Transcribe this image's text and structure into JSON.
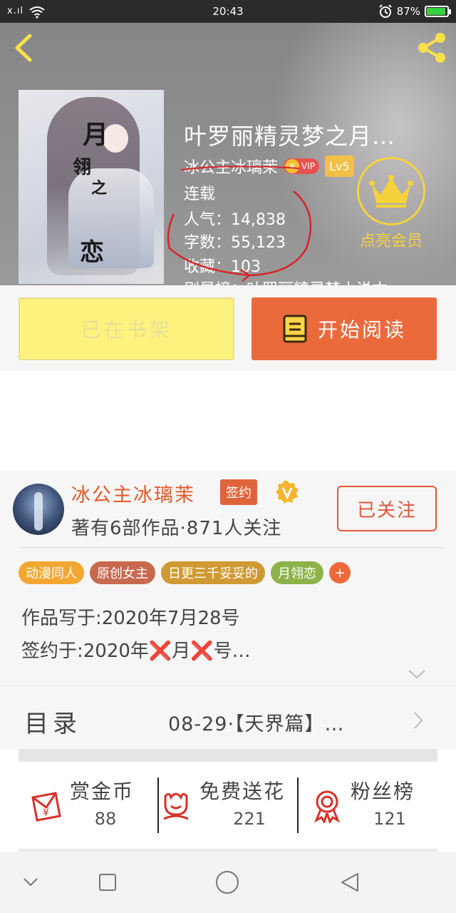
{
  "status_bar": {
    "signal": "x.ıl",
    "time": "20:43",
    "battery_text": "87%",
    "battery_level": 0.87
  },
  "book": {
    "title": "叶罗丽精灵梦之月…",
    "author": "冰公主冰璃茉",
    "vip_label": "VIP",
    "level": "Lv5",
    "status": "连载",
    "popularity": "人气：14,838",
    "word_count": "字数：55,123",
    "favorites": "收藏：103",
    "ranking": "剧星榜：叶罗丽精灵梦小说本…",
    "cover_chars": [
      "月",
      "翎",
      "之",
      "恋"
    ]
  },
  "member": {
    "label": "点亮会员"
  },
  "actions": {
    "shelf_label": "已在书架",
    "read_label": "开始阅读"
  },
  "author_card": {
    "name": "冰公主冰璃茉",
    "sign_tag": "签约",
    "meta": "著有6部作品·871人关注",
    "follow_label": "已关注",
    "tags": [
      {
        "label": "动漫同人",
        "color": "#f2a733"
      },
      {
        "label": "原创女主",
        "color": "#c8694f"
      },
      {
        "label": "日更三千妥妥的",
        "color": "#cf9a33"
      },
      {
        "label": "月翎恋",
        "color": "#8db24a"
      },
      {
        "label": "+",
        "color": "#ec6a3b"
      }
    ],
    "written_on": "作品写于:2020年7月28号",
    "signed_on": "签约于:2020年❌月❌号…"
  },
  "catalog": {
    "title": "目录",
    "latest": "08-29·【天界篇】…"
  },
  "stats": [
    {
      "label": "赏金币",
      "value": "88",
      "icon": "red-envelope-icon"
    },
    {
      "label": "免费送花",
      "value": "221",
      "icon": "flower-icon"
    },
    {
      "label": "粉丝榜",
      "value": "121",
      "icon": "medal-icon"
    }
  ],
  "colors": {
    "accent": "#ea6a3c",
    "shelf_button": "#fdf27d",
    "member_gold": "#f5d23c",
    "author_name": "#e05a2a"
  }
}
